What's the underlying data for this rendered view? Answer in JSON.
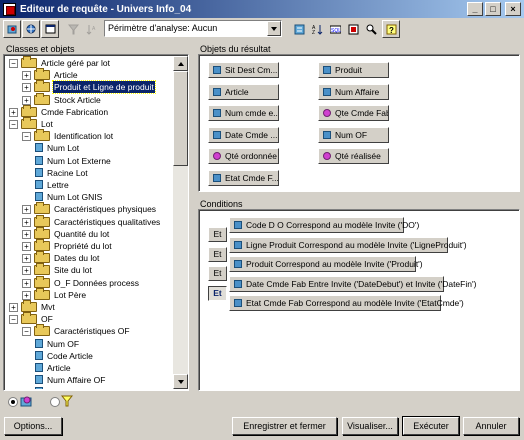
{
  "window": {
    "title": "Editeur de requête - Univers Info_04"
  },
  "toolbar": {
    "scope_combo_value": "Périmètre d'analyse: Aucun",
    "left_buttons": [
      "data-icon",
      "universe-icon",
      "window-icon",
      "filter-icon",
      "sort-icon"
    ],
    "right_buttons": [
      "calc-icon",
      "sort-az-icon",
      "sql-icon",
      "properties-icon",
      "zoom-icon",
      "help-icon"
    ]
  },
  "left_panel": {
    "title": "Classes et objets",
    "tree": [
      {
        "label": "Article géré par lot",
        "level": 1,
        "type": "folder",
        "expander": "-"
      },
      {
        "label": "Article",
        "level": 2,
        "type": "folder",
        "expander": "+"
      },
      {
        "label": "Produit et Ligne de produit",
        "level": 2,
        "type": "folder",
        "expander": "+",
        "selected": true
      },
      {
        "label": "Stock Article",
        "level": 2,
        "type": "folder",
        "expander": "+"
      },
      {
        "label": "Cmde Fabrication",
        "level": 1,
        "type": "folder",
        "expander": "+"
      },
      {
        "label": "Lot",
        "level": 1,
        "type": "folder",
        "expander": "-"
      },
      {
        "label": "Identification lot",
        "level": 2,
        "type": "folder",
        "expander": "-"
      },
      {
        "label": "Num Lot",
        "level": 3,
        "type": "object"
      },
      {
        "label": "Num Lot Externe",
        "level": 3,
        "type": "object"
      },
      {
        "label": "Racine Lot",
        "level": 3,
        "type": "object"
      },
      {
        "label": "Lettre",
        "level": 3,
        "type": "object"
      },
      {
        "label": "Num Lot GNIS",
        "level": 3,
        "type": "object"
      },
      {
        "label": "Caractéristiques physiques",
        "level": 2,
        "type": "folder",
        "expander": "+"
      },
      {
        "label": "Caractéristiques qualitatives",
        "level": 2,
        "type": "folder",
        "expander": "+"
      },
      {
        "label": "Quantité du lot",
        "level": 2,
        "type": "folder",
        "expander": "+"
      },
      {
        "label": "Propriété du lot",
        "level": 2,
        "type": "folder",
        "expander": "+"
      },
      {
        "label": "Dates du lot",
        "level": 2,
        "type": "folder",
        "expander": "+"
      },
      {
        "label": "Site du lot",
        "level": 2,
        "type": "folder",
        "expander": "+"
      },
      {
        "label": "O_F Données process",
        "level": 2,
        "type": "folder",
        "expander": "+"
      },
      {
        "label": "Lot Père",
        "level": 2,
        "type": "folder",
        "expander": "+"
      },
      {
        "label": "Mvt",
        "level": 1,
        "type": "folder",
        "expander": "+"
      },
      {
        "label": "OF",
        "level": 1,
        "type": "folder",
        "expander": "-"
      },
      {
        "label": "Caractéristiques OF",
        "level": 2,
        "type": "folder",
        "expander": "-"
      },
      {
        "label": "Num OF",
        "level": 3,
        "type": "object"
      },
      {
        "label": "Code Article",
        "level": 3,
        "type": "object"
      },
      {
        "label": "Article",
        "level": 3,
        "type": "object"
      },
      {
        "label": "Num Affaire OF",
        "level": 3,
        "type": "object"
      },
      {
        "label": "Emplacement",
        "level": 3,
        "type": "object"
      }
    ],
    "view_mode": "objects"
  },
  "result_objects": {
    "title": "Objets du résultat",
    "items": [
      {
        "label": "Sit Dest Cm...",
        "kind": "dimension"
      },
      {
        "label": "Produit",
        "kind": "dimension"
      },
      {
        "label": "Article",
        "kind": "dimension"
      },
      {
        "label": "Num Affaire",
        "kind": "dimension"
      },
      {
        "label": "Num cmde e...",
        "kind": "dimension"
      },
      {
        "label": "Qte Cmde Fab",
        "kind": "measure"
      },
      {
        "label": "Date Cmde ...",
        "kind": "dimension"
      },
      {
        "label": "Num OF",
        "kind": "dimension"
      },
      {
        "label": "Qté ordonnée",
        "kind": "measure"
      },
      {
        "label": "Qté réalisée",
        "kind": "measure"
      },
      {
        "label": "Etat Cmde F...",
        "kind": "dimension"
      }
    ]
  },
  "conditions": {
    "title": "Conditions",
    "operator_label": "Et",
    "items": [
      "Code D O Correspond au modèle Invite ('DO')",
      "Ligne Produit Correspond au modèle Invite ('LigneProduit')",
      "Produit Correspond au modèle Invite ('Produit')",
      "Date Cmde Fab Entre Invite ('DateDebut') et Invite ('DateFin')",
      "Etat Cmde Fab Correspond au modèle Invite ('EtatCmde')"
    ]
  },
  "buttons": {
    "options": "Options...",
    "save_close": "Enregistrer et fermer",
    "preview": "Visualiser...",
    "run": "Exécuter",
    "cancel": "Annuler"
  }
}
